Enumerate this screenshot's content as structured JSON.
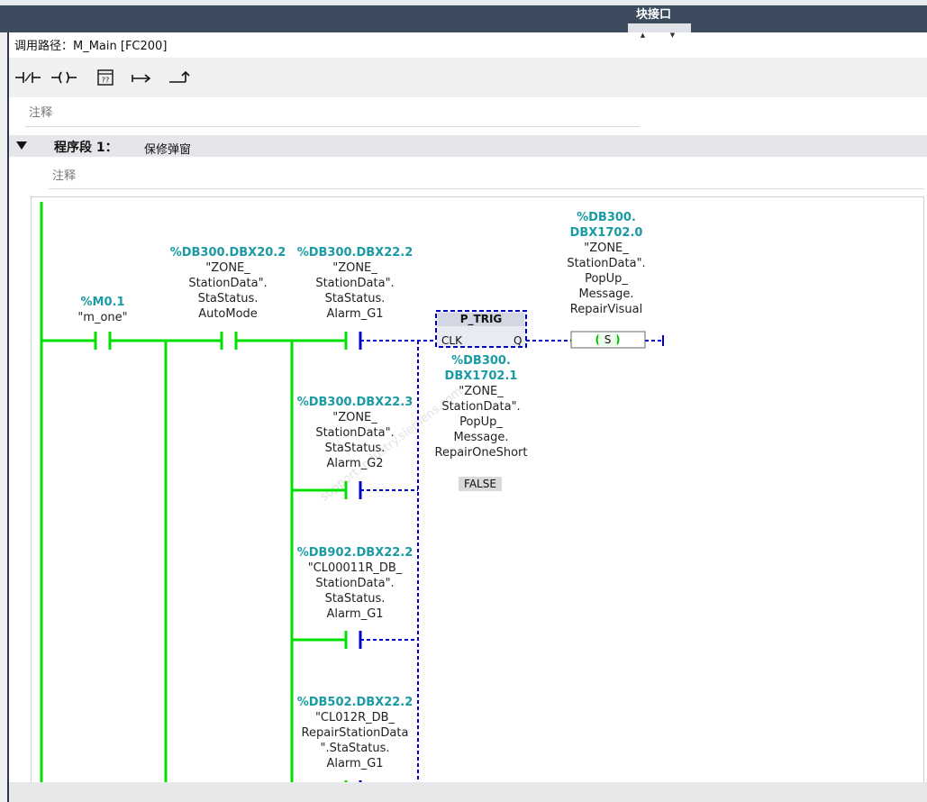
{
  "window": {
    "title": "块接口",
    "scroll_up": "▲",
    "scroll_down": "▼"
  },
  "call_path": "调用路径：M_Main [FC200]",
  "toolbar": {
    "items": [
      {
        "name": "normally-open-contact-button",
        "label": "—|/|—"
      },
      {
        "name": "coil-button",
        "label": "—( )—"
      },
      {
        "name": "empty-box-button",
        "label": "[??]"
      },
      {
        "name": "open-branch-button",
        "label": "↦"
      },
      {
        "name": "close-branch-button",
        "label": "⤴"
      }
    ]
  },
  "block_comment": "注释",
  "network": {
    "label": "程序段 1：",
    "title": "保修弹窗",
    "comment": "注释"
  },
  "ladder": {
    "contacts": [
      {
        "address": "%M0.1",
        "symbol": [
          "\"m_one\""
        ]
      },
      {
        "address": "%DB300.DBX20.2",
        "symbol": [
          "\"ZONE_",
          "StationData\".",
          "StaStatus.",
          "AutoMode"
        ]
      },
      {
        "address": "%DB300.DBX22.2",
        "symbol": [
          "\"ZONE_",
          "StationData\".",
          "StaStatus.",
          "Alarm_G1"
        ]
      },
      {
        "address": "%DB300.DBX22.3",
        "symbol": [
          "\"ZONE_",
          "StationData\".",
          "StaStatus.",
          "Alarm_G2"
        ]
      },
      {
        "address": "%DB902.DBX22.2",
        "symbol": [
          "\"CL00011R_DB_",
          "StationData\".",
          "StaStatus.",
          "Alarm_G1"
        ]
      },
      {
        "address": "%DB502.DBX22.2",
        "symbol": [
          "\"CL012R_DB_",
          "RepairStationData",
          "\".StaStatus.",
          "Alarm_G1"
        ]
      }
    ],
    "trig": {
      "name": "P_TRIG",
      "input": "CLK",
      "output": "Q",
      "address": [
        "%DB300.",
        "DBX1702.1"
      ],
      "symbol": [
        "\"ZONE_",
        "StationData\".",
        "PopUp_",
        "Message.",
        "RepairOneShort"
      ],
      "value": "FALSE"
    },
    "coil": {
      "type": "S",
      "address": [
        "%DB300.",
        "DBX1702.0"
      ],
      "symbol": [
        "\"ZONE_",
        "StationData\".",
        "PopUp_",
        "Message.",
        "RepairVisual"
      ]
    }
  },
  "colors": {
    "power": "#00e000",
    "unpowered": "#0000cc",
    "operand": "#1a9ba3",
    "header": "#3c4b5e"
  }
}
